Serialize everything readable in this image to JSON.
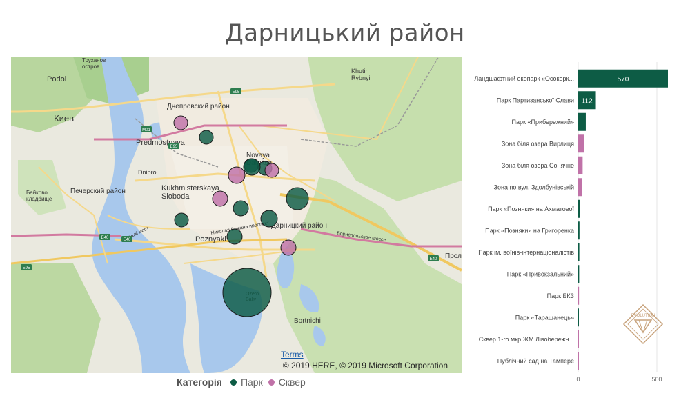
{
  "title": "Дарницький район",
  "map": {
    "labels": [
      {
        "text": "Podol"
      },
      {
        "text": "Киев"
      },
      {
        "text": "Труханов\nостров"
      },
      {
        "text": "Днепровский район"
      },
      {
        "text": "Predmostnaya"
      },
      {
        "text": "Dnipro"
      },
      {
        "text": "Печерский район"
      },
      {
        "text": "Байково\nкладбище"
      },
      {
        "text": "Kukhmisterskaya\nSloboda"
      },
      {
        "text": "Novaya\nDarnitsa"
      },
      {
        "text": "Khutir\nRybnyi"
      },
      {
        "text": "Дарницкий район"
      },
      {
        "text": "Poznyaki"
      },
      {
        "text": "Bortnichi"
      },
      {
        "text": "Прол"
      },
      {
        "text": "Ozero\nBaliv"
      },
      {
        "text": "Бориспольское шоссе"
      },
      {
        "text": "Южный мост"
      },
      {
        "text": "Николая Бажана проспект"
      }
    ],
    "road_badges": [
      "E95",
      "M01",
      "E95",
      "E40",
      "E40",
      "E95",
      "E40"
    ],
    "terms": "Terms",
    "copyright": "© 2019 HERE, © 2019 Microsoft Corporation",
    "bubbles": [
      {
        "category": "Сквер",
        "size": 10
      },
      {
        "category": "Парк",
        "size": 10
      },
      {
        "category": "Парк",
        "size": 10
      },
      {
        "category": "Сквер",
        "size": 12
      },
      {
        "category": "Парк",
        "size": 10
      },
      {
        "category": "Сквер",
        "size": 10
      },
      {
        "category": "Парк",
        "size": 12
      },
      {
        "category": "Парк",
        "size": 16
      },
      {
        "category": "Сквер",
        "size": 11
      },
      {
        "category": "Парк",
        "size": 11
      },
      {
        "category": "Парк",
        "size": 12
      },
      {
        "category": "Парк",
        "size": 10
      },
      {
        "category": "Парк",
        "size": 11
      },
      {
        "category": "Сквер",
        "size": 11
      },
      {
        "category": "Парк",
        "size": 35
      }
    ]
  },
  "legend": {
    "title": "Категорія",
    "items": [
      {
        "label": "Парк",
        "color": "#0d5c45"
      },
      {
        "label": "Сквер",
        "color": "#c072a8"
      }
    ]
  },
  "colors": {
    "park": "#0d5c45",
    "square": "#c072a8"
  },
  "chart_data": {
    "type": "bar",
    "orientation": "horizontal",
    "categories": [
      "Ландшафтний екопарк «Осокорк...",
      "Парк Партизанської Слави",
      "Парк «Прибережний»",
      "Зона біля озера Вирлиця",
      "Зона біля озера Сонячне",
      "Зона по вул. Здолбунівській",
      "Парк «Позняки» на Ахматової",
      "Парк «Позняки» на Григоренка",
      "Парк ім. воїнів-інтернаціоналістів",
      "Парк «Привокзальний»",
      "Парк БКЗ",
      "Парк «Таращанець»",
      "Сквер 1-го мкр ЖМ Лівобережн...",
      "Публічний сад на Тампере"
    ],
    "values": [
      570,
      112,
      48,
      38,
      28,
      22,
      9,
      8,
      7,
      6,
      5,
      4,
      2,
      2
    ],
    "bar_categories": [
      "Парк",
      "Парк",
      "Парк",
      "Сквер",
      "Сквер",
      "Сквер",
      "Парк",
      "Парк",
      "Парк",
      "Парк",
      "Сквер",
      "Парк",
      "Сквер",
      "Сквер"
    ],
    "data_labels": [
      "570",
      "112"
    ],
    "xlim": [
      0,
      570
    ],
    "xticks": [
      "0",
      "500"
    ]
  },
  "logo": {
    "text": "EVOLUTION"
  }
}
